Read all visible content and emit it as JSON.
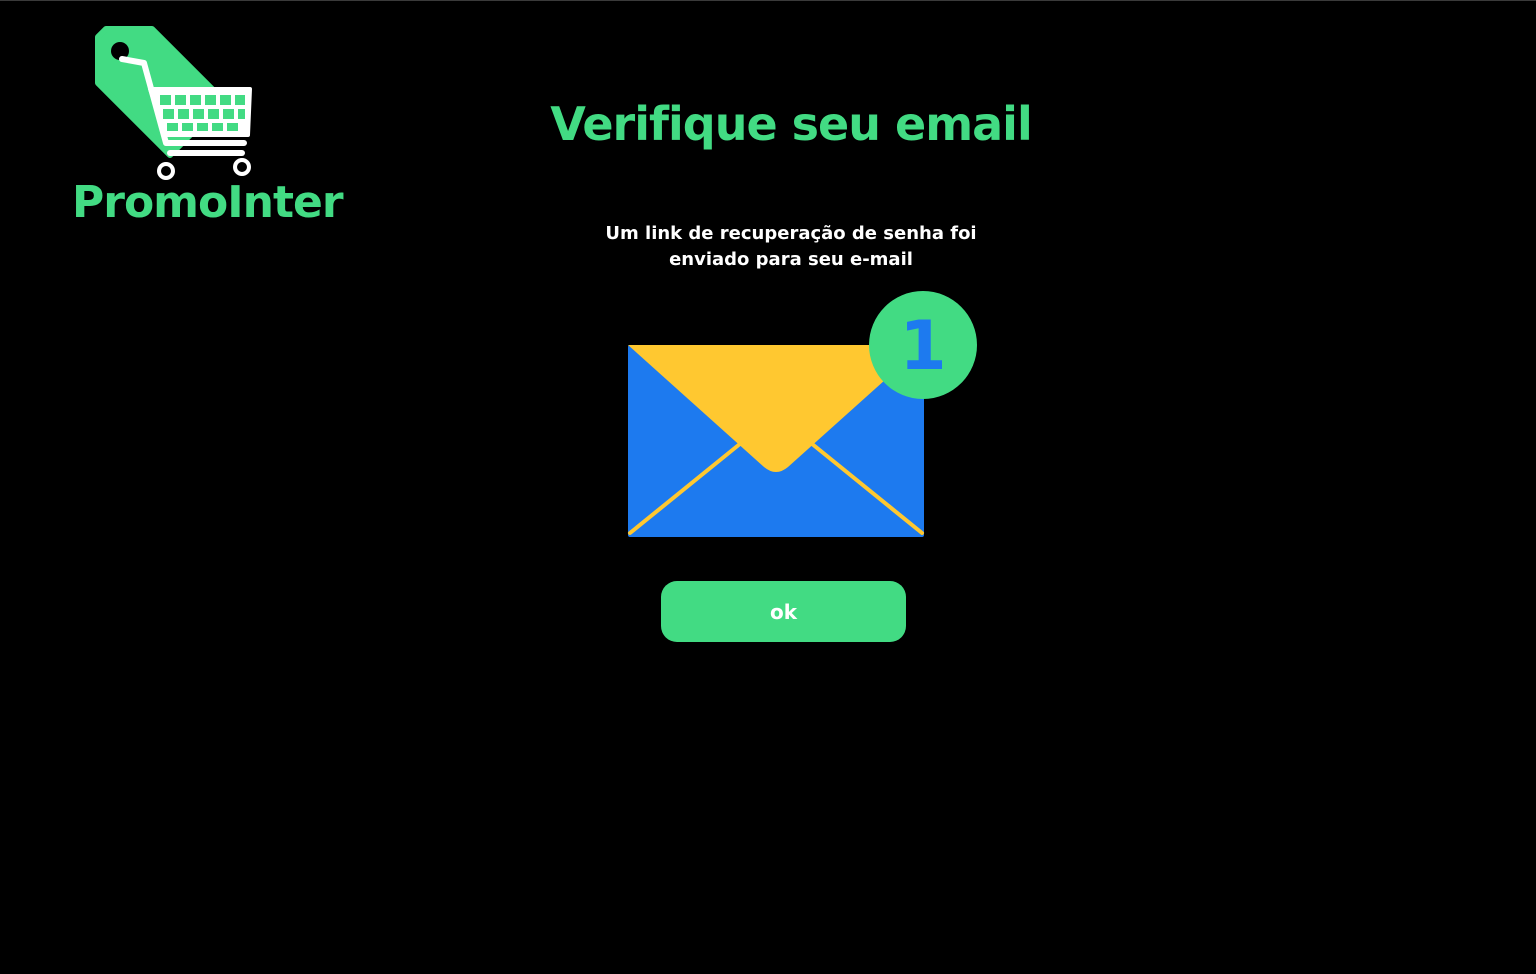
{
  "brand": {
    "name": "PromoInter",
    "color": "#42db83"
  },
  "page": {
    "title": "Verifique seu email",
    "message_line1": "Um link de recuperação de senha foi",
    "message_line2": "enviado para seu e-mail"
  },
  "envelope_icon": {
    "badge_count": "1",
    "envelope_color": "#1d7aef",
    "flap_color": "#ffc830",
    "badge_color": "#42db83"
  },
  "actions": {
    "ok_label": "ok"
  }
}
